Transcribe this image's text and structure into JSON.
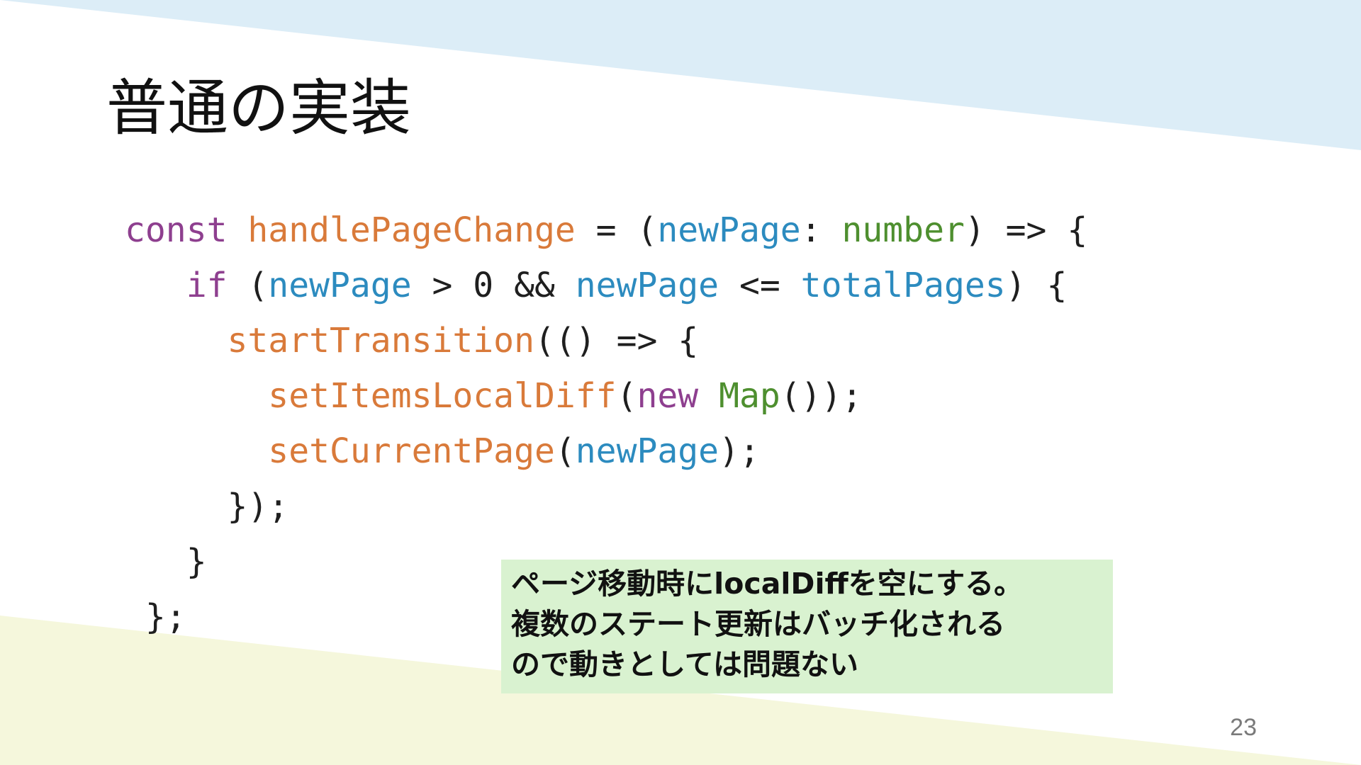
{
  "slide": {
    "title": "普通の実装",
    "page_number": "23",
    "colors": {
      "top_band": "#dcedf7",
      "bottom_band": "#f5f7dc",
      "note_background": "#d9f2d0"
    }
  },
  "code": {
    "colors": {
      "keyword": "#8e3f8f",
      "function": "#d97a3a",
      "variable": "#2c8bbf",
      "type": "#4e8f2f",
      "plain": "#1f1f1f"
    },
    "lines": [
      {
        "indent": "",
        "tokens": [
          {
            "text": "const",
            "kind": "keyword"
          },
          {
            "text": " ",
            "kind": "plain"
          },
          {
            "text": "handlePageChange",
            "kind": "function"
          },
          {
            "text": " = (",
            "kind": "plain"
          },
          {
            "text": "newPage",
            "kind": "variable"
          },
          {
            "text": ": ",
            "kind": "plain"
          },
          {
            "text": "number",
            "kind": "type"
          },
          {
            "text": ") => {",
            "kind": "plain"
          }
        ]
      },
      {
        "indent": "   ",
        "tokens": [
          {
            "text": "if",
            "kind": "keyword"
          },
          {
            "text": " (",
            "kind": "plain"
          },
          {
            "text": "newPage",
            "kind": "variable"
          },
          {
            "text": " > 0 && ",
            "kind": "plain"
          },
          {
            "text": "newPage",
            "kind": "variable"
          },
          {
            "text": " <= ",
            "kind": "plain"
          },
          {
            "text": "totalPages",
            "kind": "variable"
          },
          {
            "text": ") {",
            "kind": "plain"
          }
        ]
      },
      {
        "indent": "     ",
        "tokens": [
          {
            "text": "startTransition",
            "kind": "function"
          },
          {
            "text": "(() => {",
            "kind": "plain"
          }
        ]
      },
      {
        "indent": "       ",
        "tokens": [
          {
            "text": "setItemsLocalDiff",
            "kind": "function"
          },
          {
            "text": "(",
            "kind": "plain"
          },
          {
            "text": "new",
            "kind": "keyword"
          },
          {
            "text": " ",
            "kind": "plain"
          },
          {
            "text": "Map",
            "kind": "type"
          },
          {
            "text": "());",
            "kind": "plain"
          }
        ]
      },
      {
        "indent": "       ",
        "tokens": [
          {
            "text": "setCurrentPage",
            "kind": "function"
          },
          {
            "text": "(",
            "kind": "plain"
          },
          {
            "text": "newPage",
            "kind": "variable"
          },
          {
            "text": ");",
            "kind": "plain"
          }
        ]
      },
      {
        "indent": "     ",
        "tokens": [
          {
            "text": "});",
            "kind": "plain"
          }
        ]
      },
      {
        "indent": "   ",
        "tokens": [
          {
            "text": "}",
            "kind": "plain"
          }
        ]
      },
      {
        "indent": " ",
        "tokens": [
          {
            "text": "};",
            "kind": "plain"
          }
        ]
      }
    ]
  },
  "note": {
    "lines": [
      "ページ移動時にlocalDiffを空にする。",
      "複数のステート更新はバッチ化される",
      "ので動きとしては問題ない"
    ]
  }
}
